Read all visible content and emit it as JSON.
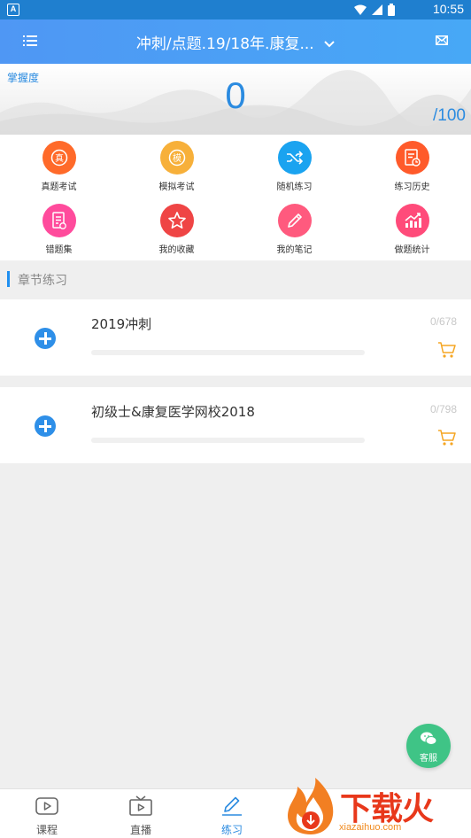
{
  "status_bar": {
    "time": "10:55",
    "app_icon_letter": "A"
  },
  "app_bar": {
    "title": "冲刺/点题.19/18年.康复...",
    "icons": [
      "menu-icon",
      "chevron-down-icon",
      "mail-icon"
    ]
  },
  "mastery": {
    "label": "掌握度",
    "score": "0",
    "total": "/100",
    "color": "#2b8be0"
  },
  "grid": {
    "items": [
      {
        "label": "真题考试",
        "icon": "real-exam-icon",
        "color": "#ff6a2a",
        "glyph": "真"
      },
      {
        "label": "模拟考试",
        "icon": "mock-exam-icon",
        "color": "#f7b03a",
        "glyph": "模"
      },
      {
        "label": "随机练习",
        "icon": "shuffle-icon",
        "color": "#1aa3f0",
        "glyph": ""
      },
      {
        "label": "练习历史",
        "icon": "history-icon",
        "color": "#ff5a2a",
        "glyph": ""
      },
      {
        "label": "错题集",
        "icon": "wrong-questions-icon",
        "color": "#ff4b9c",
        "glyph": ""
      },
      {
        "label": "我的收藏",
        "icon": "star-icon",
        "color": "#ef4545",
        "glyph": ""
      },
      {
        "label": "我的笔记",
        "icon": "pencil-icon",
        "color": "#ff5a7e",
        "glyph": ""
      },
      {
        "label": "做题统计",
        "icon": "chart-icon",
        "color": "#ff4b7a",
        "glyph": ""
      }
    ]
  },
  "section": {
    "title": "章节练习"
  },
  "chapters": [
    {
      "name": "2019冲刺",
      "count": "0/678",
      "progress": 0
    },
    {
      "name": "初级士&康复医学网校2018",
      "count": "0/798",
      "progress": 0
    }
  ],
  "customer_service": {
    "label": "客服"
  },
  "tabs": [
    {
      "label": "课程",
      "icon": "course-icon",
      "active": false
    },
    {
      "label": "直播",
      "icon": "live-tv-icon",
      "active": false
    },
    {
      "label": "练习",
      "icon": "practice-pencil-icon",
      "active": true
    }
  ],
  "watermark": {
    "text": "下载火",
    "url": "xiazaihuo.com"
  }
}
